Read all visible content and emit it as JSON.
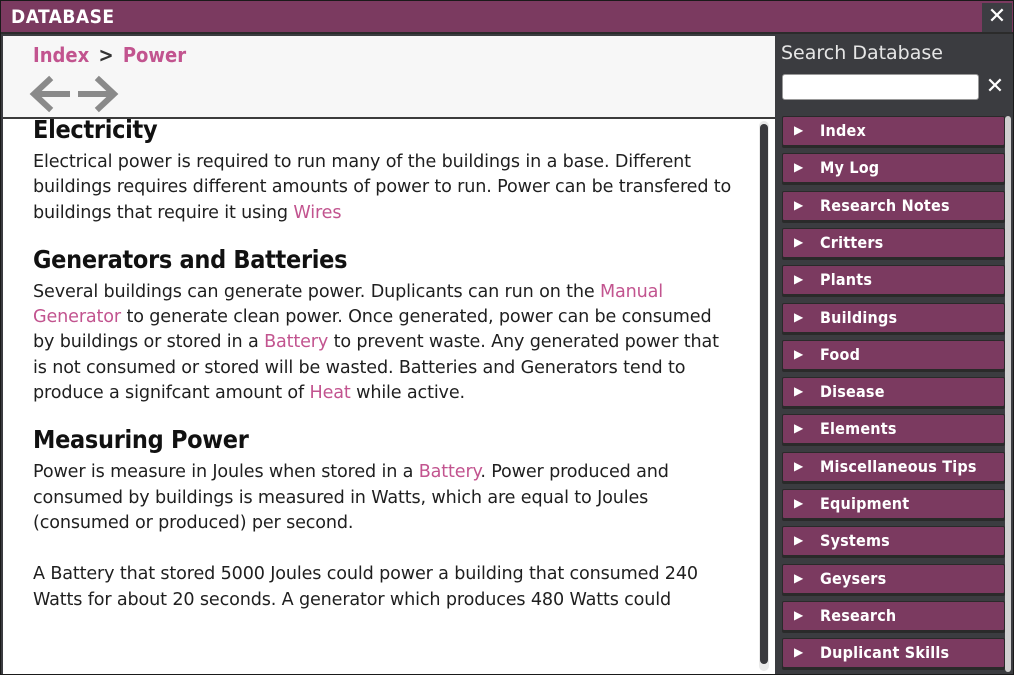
{
  "window": {
    "title": "DATABASE",
    "close_glyph": "✕"
  },
  "breadcrumb": {
    "items": [
      "Index",
      "Power"
    ],
    "separator": ">"
  },
  "nav": {
    "back_icon": "arrow-left-icon",
    "forward_icon": "arrow-right-icon"
  },
  "article": {
    "sections": [
      {
        "heading": "Electricity",
        "p1_text": "Electrical power is required to run many of the buildings in a base. Different buildings requires different amounts of power to run. Power can be transfered to buildings that require it using ",
        "p1_link": "Wires"
      },
      {
        "heading": "Generators and Batteries",
        "p1_a": "Several buildings can generate power. Duplicants can run on the ",
        "p1_link1": "Manual Generator",
        "p1_b": " to generate clean power. Once generated, power can be consumed by buildings or stored in a ",
        "p1_link2": "Battery",
        "p1_c": " to prevent waste. Any generated power that is not consumed or stored will be wasted. Batteries and Generators tend to produce a signifcant amount of ",
        "p1_link3": "Heat",
        "p1_d": " while active."
      },
      {
        "heading": "Measuring Power",
        "p1_a": "Power is measure in Joules when stored in a ",
        "p1_link1": "Battery",
        "p1_b": ". Power produced and consumed by buildings is measured in Watts, which are equal to Joules (consumed or produced) per second.",
        "p2": "A Battery that stored 5000 Joules could power a building that consumed 240 Watts for about 20 seconds. A generator which produces 480 Watts could"
      }
    ]
  },
  "sidebar": {
    "search_label": "Search Database",
    "search_value": "",
    "clear_glyph": "✕",
    "expand_glyph": "▶",
    "categories": [
      "Index",
      "My Log",
      "Research Notes",
      "Critters",
      "Plants",
      "Buildings",
      "Food",
      "Disease",
      "Elements",
      "Miscellaneous Tips",
      "Equipment",
      "Systems",
      "Geysers",
      "Research",
      "Duplicant Skills"
    ]
  },
  "colors": {
    "accent": "#7b3a60",
    "link": "#c2548f",
    "panel": "#3b3c40"
  }
}
